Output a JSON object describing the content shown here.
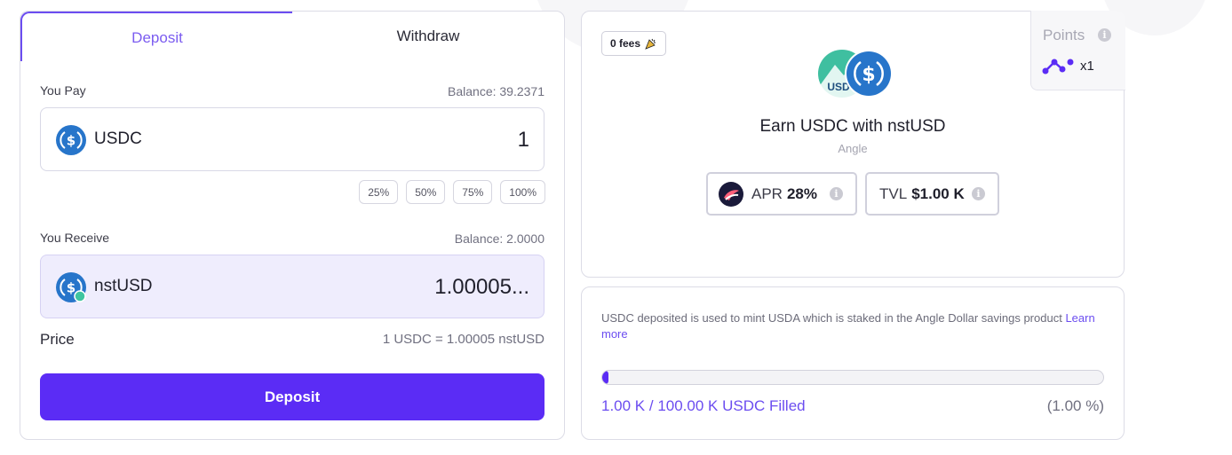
{
  "tabs": {
    "deposit": "Deposit",
    "withdraw": "Withdraw"
  },
  "pay": {
    "label": "You Pay",
    "balance": "Balance: 39.2371",
    "token": "USDC",
    "amount": "1",
    "percent_buttons": [
      "25%",
      "50%",
      "75%",
      "100%"
    ]
  },
  "receive": {
    "label": "You Receive",
    "balance": "Balance: 2.0000",
    "token": "nstUSD",
    "amount": "1.00005..."
  },
  "price": {
    "label": "Price",
    "value": "1 USDC = 1.00005 nstUSD"
  },
  "deposit_button": "Deposit",
  "vault": {
    "fees_badge": "0 fees",
    "title": "Earn USDC with nstUSD",
    "subtitle": "Angle",
    "apr_label": "APR",
    "apr_value": "28%",
    "tvl_label": "TVL",
    "tvl_value": "$1.00 K",
    "points_label": "Points",
    "points_multiplier": "x1",
    "hero_badge_text": "USD"
  },
  "info": {
    "text": "USDC deposited is used to mint USDA which is staked in the Angle Dollar savings product",
    "link": "Learn more",
    "filled_label": "1.00 K / 100.00 K USDC Filled",
    "filled_pct": "(1.00 %)",
    "progress_fraction": 0.01
  },
  "icons": {
    "usdc": "usdc-coin-icon",
    "nstusd": "nstusd-coin-icon",
    "info": "info-icon",
    "party": "party-popper-icon",
    "points": "points-dots-icon",
    "apr_logo": "protocol-logo-icon"
  },
  "colors": {
    "accent": "#5b2cf5",
    "accent_text": "#6b4df0",
    "usdc_blue": "#2775ca",
    "receive_bg": "#efedfd"
  }
}
